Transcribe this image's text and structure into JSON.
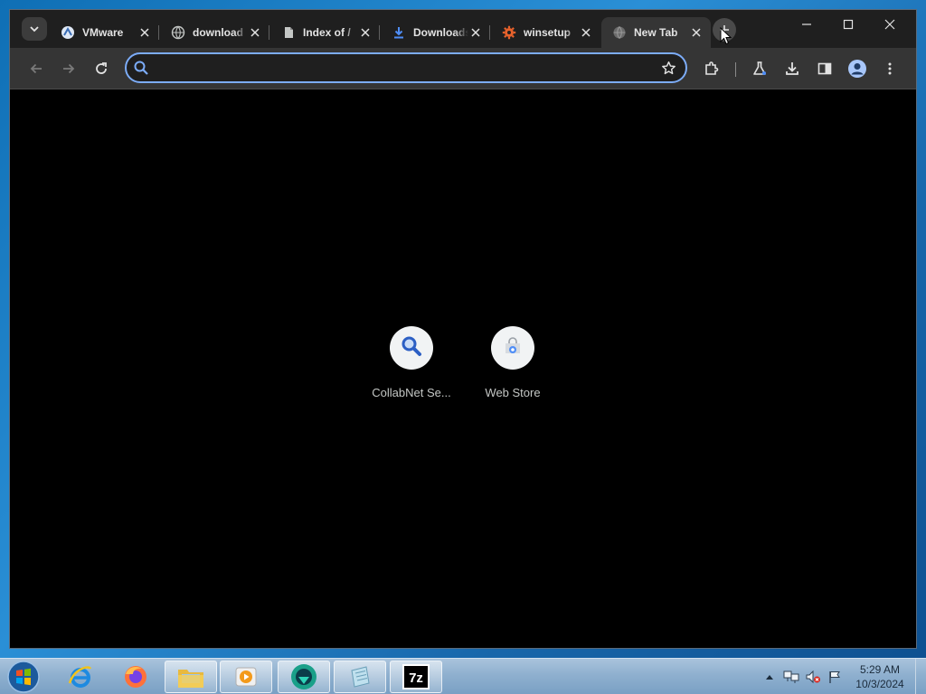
{
  "browser": {
    "tabs": [
      {
        "title": "VMware",
        "icon": "vmware-icon"
      },
      {
        "title": "download",
        "icon": "globe-icon"
      },
      {
        "title": "Index of /",
        "icon": "page-icon"
      },
      {
        "title": "Downloads",
        "icon": "download-icon"
      },
      {
        "title": "winsetup",
        "icon": "gear-icon"
      },
      {
        "title": "New Tab",
        "icon": "globe-icon",
        "active": true
      }
    ],
    "omnibox": {
      "value": "",
      "placeholder": ""
    },
    "accent_color": "#7cacf8"
  },
  "newtab": {
    "shortcuts": [
      {
        "label": "CollabNet Se...",
        "icon": "magnifier-icon"
      },
      {
        "label": "Web Store",
        "icon": "web-store-icon"
      }
    ]
  },
  "taskbar": {
    "apps": [
      {
        "name": "internet-explorer",
        "open": false
      },
      {
        "name": "firefox",
        "open": false
      },
      {
        "name": "file-explorer",
        "open": true
      },
      {
        "name": "media-player",
        "open": true
      },
      {
        "name": "chrome-like-app",
        "open": true
      },
      {
        "name": "notepad",
        "open": true
      },
      {
        "name": "7-zip",
        "open": true,
        "label": "7z"
      }
    ],
    "clock": {
      "time": "5:29 AM",
      "date": "10/3/2024"
    }
  }
}
